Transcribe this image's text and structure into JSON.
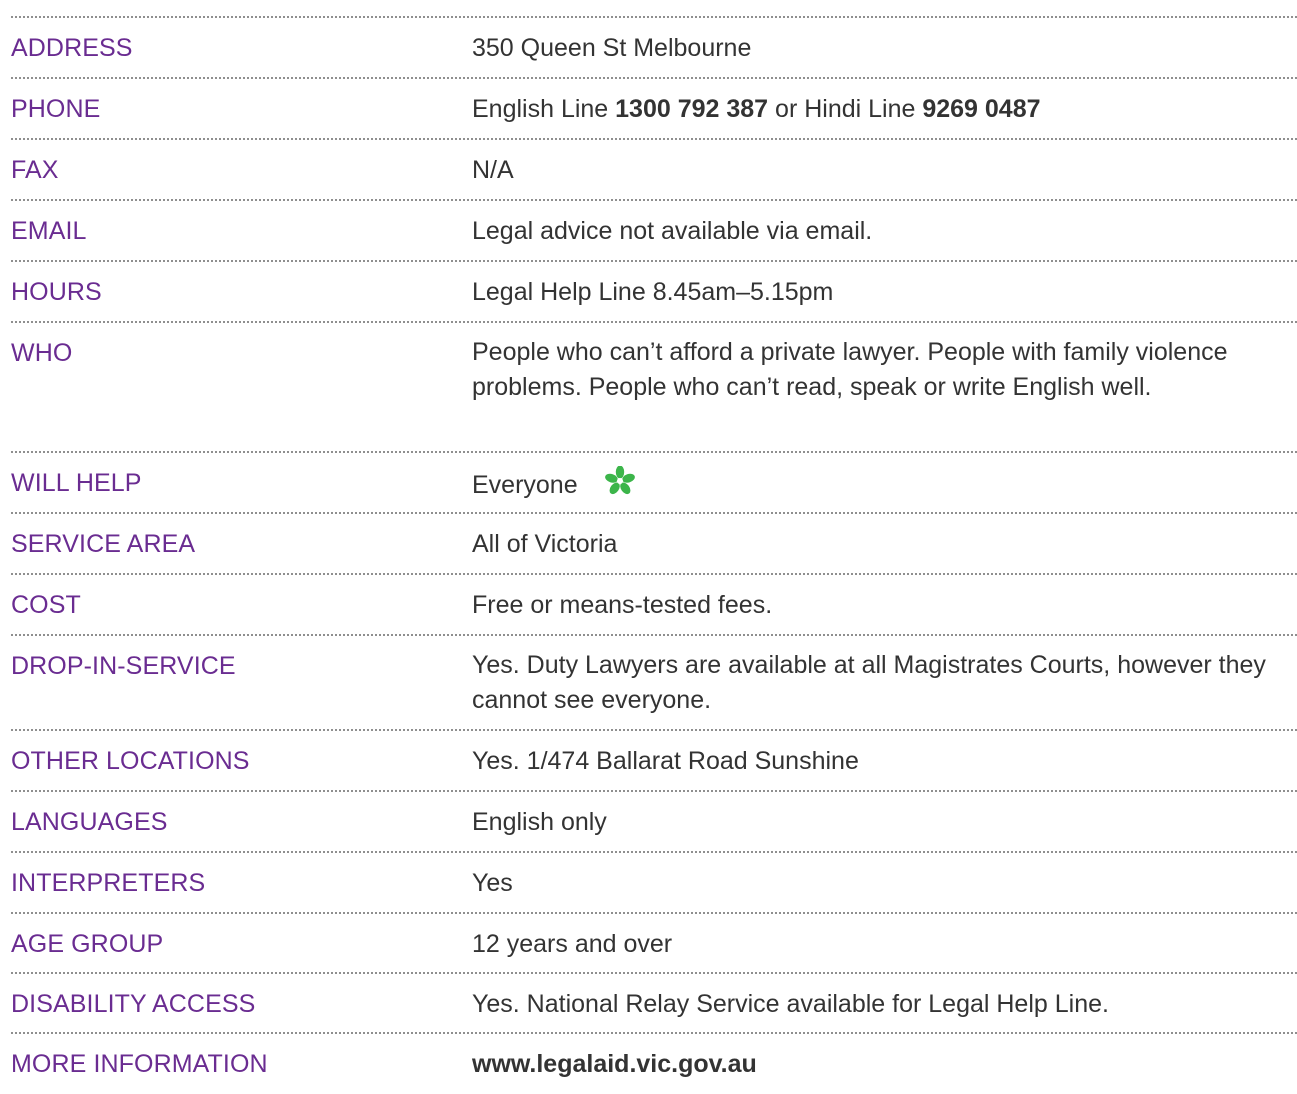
{
  "rows": [
    {
      "label": "ADDRESS",
      "value": "350 Queen St Melbourne"
    },
    {
      "label": "PHONE",
      "value_parts": {
        "prefix": "English Line ",
        "number1": "1300 792 387",
        "middle": " or Hindi Line ",
        "number2": "9269 0487"
      }
    },
    {
      "label": "FAX",
      "value": "N/A"
    },
    {
      "label": "EMAIL",
      "value": "Legal advice not available via email."
    },
    {
      "label": "HOURS",
      "value": "Legal Help Line 8.45am–5.15pm"
    },
    {
      "label": "WHO",
      "value": "People who can’t afford a private lawyer. People with family violence problems. People who can’t read, speak or write English well."
    },
    {
      "label": "WILL HELP",
      "value": "Everyone",
      "icon": "green-flower-icon"
    },
    {
      "label": "SERVICE AREA",
      "value": "All of Victoria"
    },
    {
      "label": "COST",
      "value": "Free or means-tested fees."
    },
    {
      "label": "DROP-IN-SERVICE",
      "value": "Yes. Duty Lawyers are available at all Magistrates Courts, however they cannot see everyone."
    },
    {
      "label": "OTHER LOCATIONS",
      "value": "Yes. 1/474 Ballarat Road Sunshine"
    },
    {
      "label": "LANGUAGES",
      "value": "English only"
    },
    {
      "label": "INTERPRETERS",
      "value": "Yes"
    },
    {
      "label": "AGE GROUP",
      "value": "12 years and over"
    },
    {
      "label": "DISABILITY ACCESS",
      "value": "Yes. National Relay Service available for Legal Help Line."
    },
    {
      "label": "MORE INFORMATION",
      "value": "www.legalaid.vic.gov.au"
    }
  ],
  "colors": {
    "label": "#6a2c91",
    "text": "#333333",
    "rule": "#8f8f8f",
    "flower": "#3cb54a"
  }
}
